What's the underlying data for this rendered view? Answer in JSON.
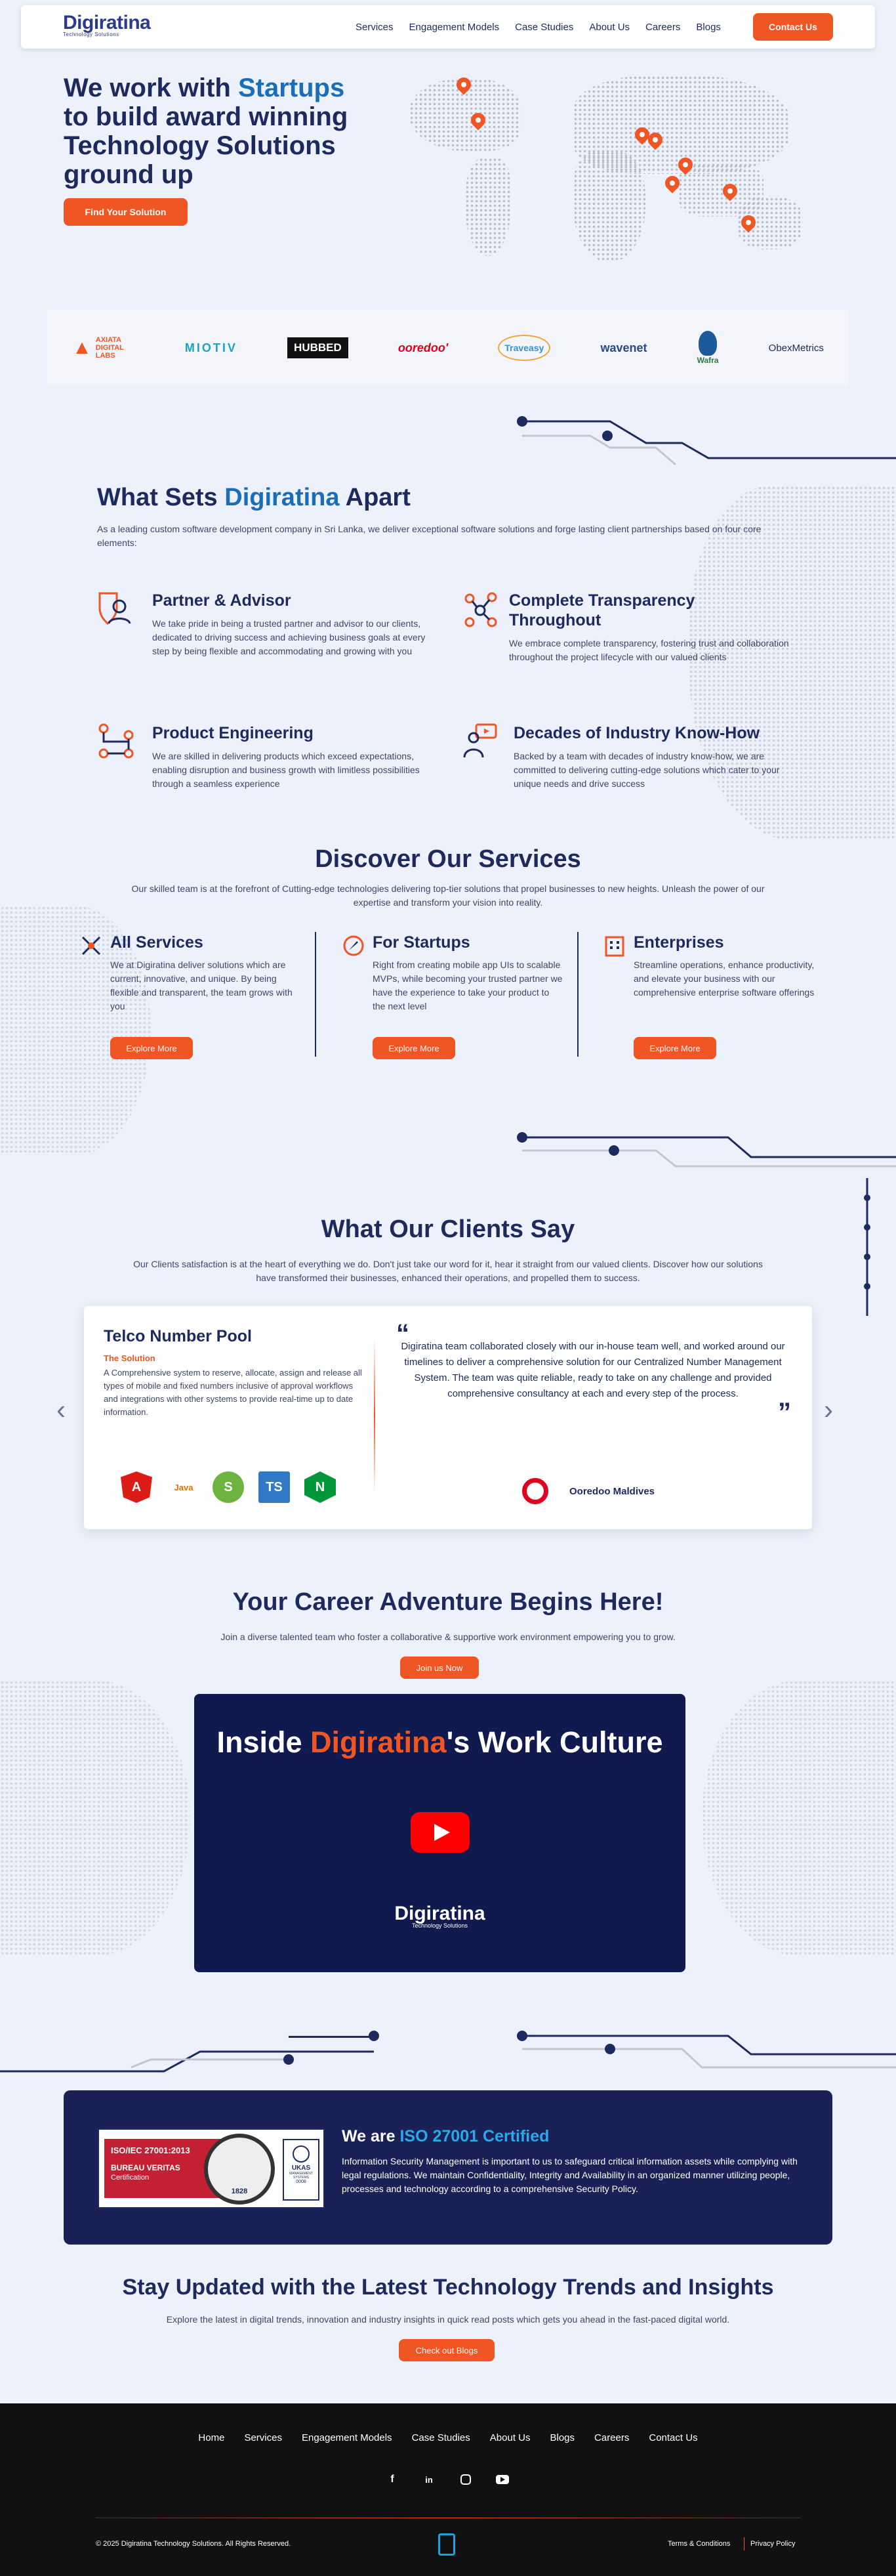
{
  "brand": {
    "logo_main": "Digiratina",
    "logo_sub": "Technology Solutions"
  },
  "nav": {
    "items": [
      "Services",
      "Engagement Models",
      "Case Studies",
      "About Us",
      "Careers",
      "Blogs"
    ],
    "cta": "Contact Us"
  },
  "hero": {
    "title_pre": "We work with ",
    "title_highlight": "Startups",
    "title_post": "to build award winning Technology Solutions ground up",
    "cta": "Find Your Solution"
  },
  "partners": [
    "AXIATA DIGITAL LABS",
    "MIOTIV",
    "HUBBED",
    "ooredoo'",
    "Traveasy",
    "wavenet",
    "Wafra",
    "ObexMetrics"
  ],
  "apart": {
    "title_pre": "What Sets ",
    "title_highlight": "Digiratina",
    "title_post": " Apart",
    "subtitle": "As a leading custom software development company in Sri Lanka, we deliver exceptional software solutions and forge lasting client partnerships based on four core elements:",
    "features": [
      {
        "title": "Partner & Advisor",
        "text": "We take pride in being a trusted partner and advisor to our clients, dedicated to driving success and achieving business goals at every step by being flexible and accommodating and growing with you"
      },
      {
        "title": "Complete Transparency Throughout",
        "text": "We embrace complete transparency, fostering trust and collaboration throughout the project lifecycle with our valued clients"
      },
      {
        "title": "Product Engineering",
        "text": "We are skilled in delivering products which exceed expectations, enabling disruption and business growth with limitless possibilities through a seamless experience"
      },
      {
        "title": "Decades of Industry Know-How",
        "text": "Backed by a team with decades of industry know-how, we are committed to delivering cutting-edge solutions which cater to your unique needs and drive success"
      }
    ]
  },
  "services": {
    "title": "Discover Our Services",
    "subtitle": "Our skilled team is at the forefront of Cutting-edge technologies delivering top-tier solutions that propel businesses to new heights. Unleash the power of our expertise and transform your vision into reality.",
    "items": [
      {
        "title": "All Services",
        "text": "We at Digiratina deliver solutions which are current, innovative, and unique. By being flexible and transparent, the team grows with you",
        "cta": "Explore More"
      },
      {
        "title": "For Startups",
        "text": "Right from creating mobile app UIs to scalable MVPs, while becoming your trusted partner we have the experience to take your product to the next level",
        "cta": "Explore More"
      },
      {
        "title": "Enterprises",
        "text": "Streamline operations, enhance productivity, and elevate your business with our comprehensive enterprise software offerings",
        "cta": "Explore More"
      }
    ]
  },
  "clients": {
    "title": "What Our Clients Say",
    "subtitle": "Our Clients satisfaction is at the heart of everything we do. Don't just take our word for it, hear it straight from our valued clients. Discover how our solutions have transformed their businesses, enhanced their operations, and propelled them to success.",
    "case_title": "Telco Number Pool",
    "case_label": "The Solution",
    "case_text": "A Comprehensive system to reserve, allocate, assign and release all types of mobile and fixed numbers inclusive of approval workflows and integrations with other systems to provide real-time up to date information.",
    "tech": [
      "A",
      "Java",
      "S",
      "TS",
      "N"
    ],
    "quote": "Digiratina team collaborated closely with our in-house team well, and worked around our timelines to deliver a comprehensive solution for our Centralized Number Management System. The team was quite reliable, ready to take on any challenge and provided comprehensive consultancy at each and every step of the process.",
    "client_name": "Ooredoo Maldives"
  },
  "career": {
    "title": "Your Career Adventure Begins Here!",
    "subtitle": "Join a diverse talented team who foster a collaborative & supportive work environment empowering you to grow.",
    "cta": "Join us Now",
    "video_pre": "Inside ",
    "video_highlight": "Digiratina",
    "video_post": "'s Work Culture",
    "video_logo": "Digiratina",
    "video_logo_sub": "Technology Solutions"
  },
  "iso": {
    "badge_line1": "ISO/IEC 27001:2013",
    "badge_line2": "BUREAU VERITAS",
    "badge_line3": "Certification",
    "seal_year": "1828",
    "ukas": "UKAS",
    "ukas_sub": "MANAGEMENT SYSTEMS",
    "ukas_num": "0008",
    "title_pre": "We are ",
    "title_highlight": "ISO 27001 Certified",
    "text": "Information Security Management is important to us to safeguard critical information assets while complying with legal regulations. We maintain Confidentiality, Integrity and Availability in an organized manner utilizing people, processes and technology according to a comprehensive Security Policy."
  },
  "blog": {
    "title": "Stay Updated with the Latest Technology Trends and Insights",
    "subtitle": "Explore the latest in digital trends, innovation and industry insights in quick read posts which gets you ahead in the fast-paced digital world.",
    "cta": "Check out Blogs"
  },
  "footer": {
    "nav": [
      "Home",
      "Services",
      "Engagement Models",
      "Case Studies",
      "About Us",
      "Blogs",
      "Careers",
      "Contact Us"
    ],
    "social": [
      "f",
      "in",
      "ig",
      "yt"
    ],
    "copyright": "© 2025 Digiratina Technology Solutions. All Rights Reserved.",
    "links": [
      "Terms & Conditions",
      "Privacy Policy"
    ]
  },
  "colors": {
    "accent": "#f05524",
    "navy": "#1d2a5e",
    "blue": "#1c6db8",
    "cyan": "#1ca0e0"
  }
}
